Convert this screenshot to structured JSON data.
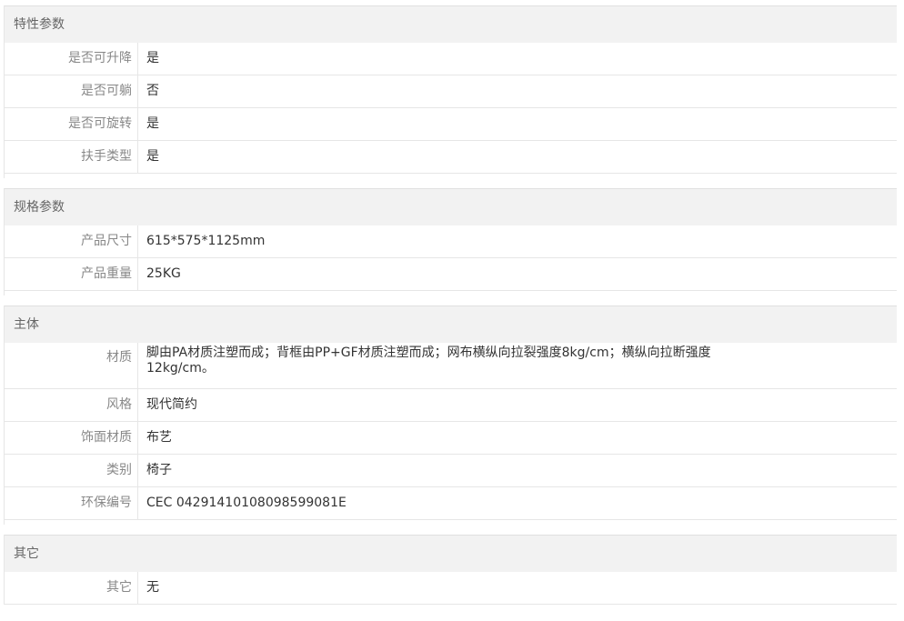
{
  "sections": [
    {
      "title": "特性参数",
      "rows": [
        {
          "label": "是否可升降",
          "value": "是"
        },
        {
          "label": "是否可躺",
          "value": "否"
        },
        {
          "label": "是否可旋转",
          "value": "是"
        },
        {
          "label": "扶手类型",
          "value": "是"
        }
      ]
    },
    {
      "title": "规格参数",
      "rows": [
        {
          "label": "产品尺寸",
          "value": "615*575*1125mm"
        },
        {
          "label": "产品重量",
          "value": "25KG"
        }
      ]
    },
    {
      "title": "主体",
      "rows": [
        {
          "label": "材质",
          "value": "脚由PA材质注塑而成；背框由PP+GF材质注塑而成；网布横纵向拉裂强度8kg/cm；横纵向拉断强度12kg/cm。"
        },
        {
          "label": "风格",
          "value": "现代简约"
        },
        {
          "label": "饰面材质",
          "value": "布艺"
        },
        {
          "label": "类别",
          "value": "椅子"
        },
        {
          "label": "环保编号",
          "value": "CEC 04291410108098599081E"
        }
      ]
    },
    {
      "title": "其它",
      "rows": [
        {
          "label": "其它",
          "value": "无"
        }
      ]
    }
  ]
}
